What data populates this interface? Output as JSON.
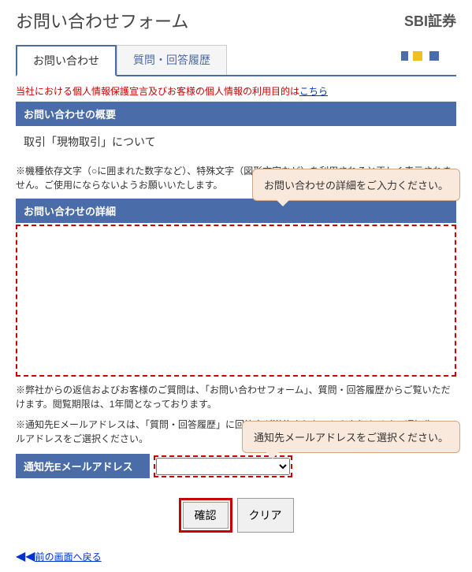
{
  "header": {
    "title": "お問い合わせフォーム",
    "brand": "SBI証券"
  },
  "tabs": {
    "inquiry": "お問い合わせ",
    "history": "質問・回答履歴"
  },
  "privacy": {
    "text": "当社における個人情報保護宣言及びお客様の個人情報の利用目的は",
    "link_text": "こちら"
  },
  "sections": {
    "overview_header": "お問い合わせの概要",
    "inquiry_topic": "取引「現物取引」について",
    "charset_note": "※機種依存文字（○に囲まれた数字など）、特殊文字（図形文字など）を利用されると正しく表示されません。ご使用にならないようお願いいたします。",
    "detail_header": "お問い合わせの詳細",
    "reply_note_1": "※弊社からの返信およびお客様のご質問は、「お問い合わせフォーム」、質問・回答履歴からご覧いただけます。閲覧期限は、1年間となっております。",
    "reply_note_2": "※通知先Eメールアドレスは、「質問・回答履歴」に回答文が送信されたことをお知らせする通知先メールアドレスをご選択ください。",
    "email_label": "通知先Eメールアドレス"
  },
  "callouts": {
    "detail": "お問い合わせの詳細をご入力ください。",
    "email": "通知先メールアドレスをご選択ください。"
  },
  "buttons": {
    "confirm": "確認",
    "clear": "クリア"
  },
  "back_link": "前の画面へ戻る",
  "textarea_value": "",
  "email_selected": ""
}
